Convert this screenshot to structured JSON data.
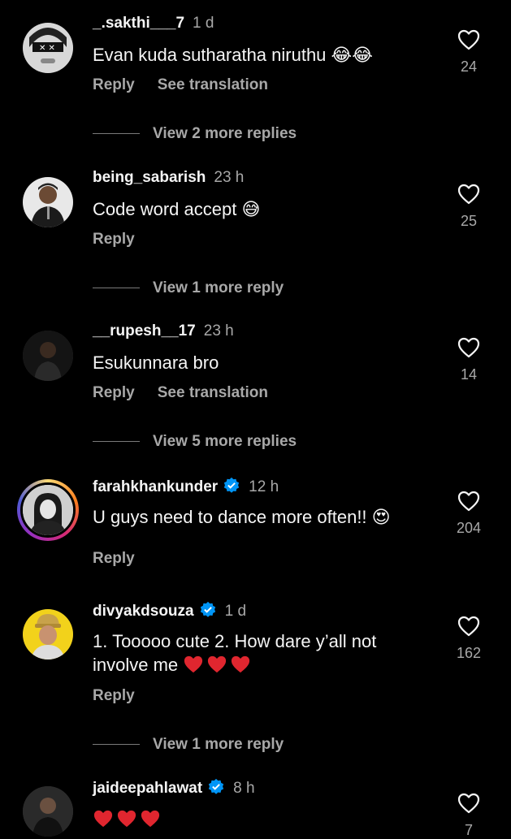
{
  "comments": [
    {
      "username": "_.sakthi___7",
      "time": "1 d",
      "verified": false,
      "text": "Evan kuda sutharatha niruthu",
      "emoji": "😂😂",
      "likes": "24",
      "reply": "Reply",
      "translation": "See translation",
      "view_more": "View 2 more replies"
    },
    {
      "username": "being_sabarish",
      "time": "23 h",
      "verified": false,
      "text": "Code word accept",
      "emoji": "😅",
      "likes": "25",
      "reply": "Reply",
      "translation": "",
      "view_more": "View 1 more reply"
    },
    {
      "username": "__rupesh__17",
      "time": "23 h",
      "verified": false,
      "text": "Esukunnara bro",
      "emoji": "",
      "likes": "14",
      "reply": "Reply",
      "translation": "See translation",
      "view_more": "View 5 more replies"
    },
    {
      "username": "farahkhankunder",
      "time": "12 h",
      "verified": true,
      "text": "U guys need to dance more often!!",
      "emoji": "😍",
      "likes": "204",
      "reply": "Reply",
      "translation": "",
      "view_more": ""
    },
    {
      "username": "divyakdsouza",
      "time": "1 d",
      "verified": true,
      "text_line1": "1. Tooooo cute 2. How dare y’all not",
      "text_line2": "involve me",
      "emoji": "",
      "likes": "162",
      "reply": "Reply",
      "translation": "",
      "view_more": "View 1 more reply"
    },
    {
      "username": "jaideepahlawat",
      "time": "8 h",
      "verified": true,
      "text": "",
      "emoji": "",
      "likes": "7",
      "reply": "",
      "translation": "",
      "view_more": ""
    }
  ],
  "icons": {
    "like": "heart-outline-icon",
    "verified": "verified-badge-icon",
    "heart_emoji": "red-heart-emoji"
  },
  "colors": {
    "background": "#000000",
    "text": "#f5f5f5",
    "secondary": "#a8a8a8",
    "verified": "#0095f6",
    "heart_emoji": "#e0262f"
  }
}
